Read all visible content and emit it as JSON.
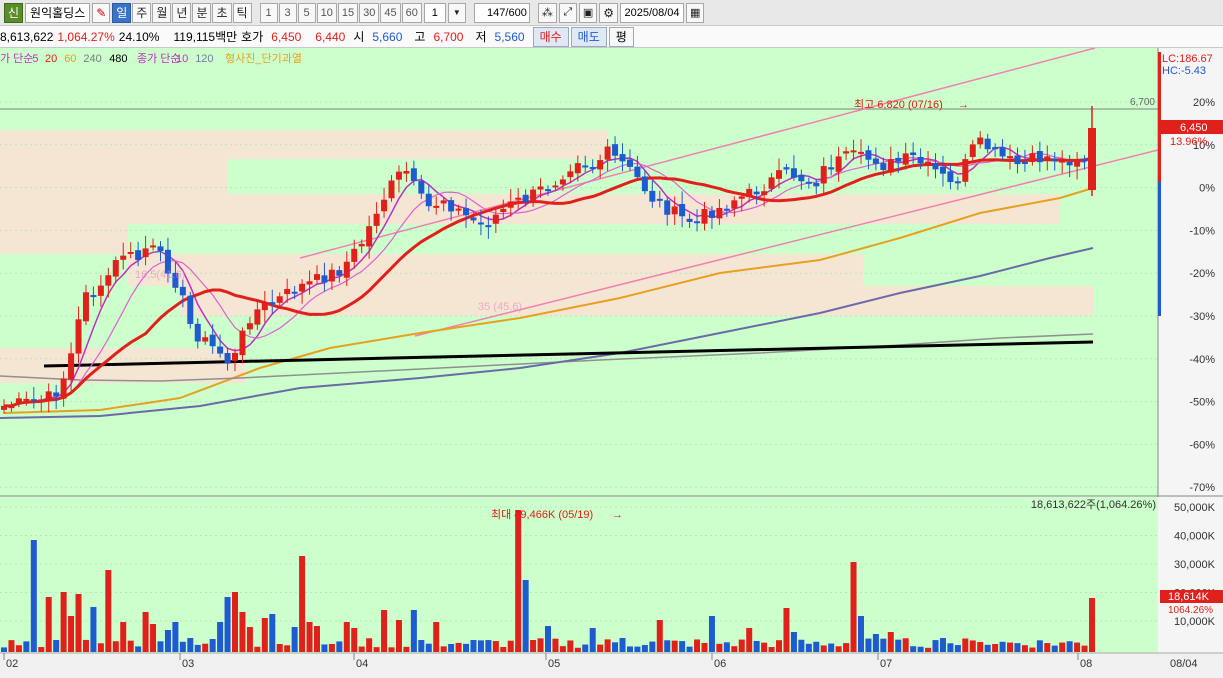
{
  "toolbar": {
    "badge": "신",
    "stock_name": "원익홀딩스",
    "period_tabs": [
      {
        "label": "일",
        "active": true
      },
      {
        "label": "주",
        "active": false
      },
      {
        "label": "월",
        "active": false
      },
      {
        "label": "년",
        "active": false
      },
      {
        "label": "분",
        "active": false
      },
      {
        "label": "초",
        "active": false
      },
      {
        "label": "틱",
        "active": false
      }
    ],
    "intervals": [
      "1",
      "3",
      "5",
      "10",
      "15",
      "30",
      "45",
      "60"
    ],
    "interval_value": "1",
    "count": "147",
    "count_total": "/600",
    "date": "2025/08/04",
    "icons": [
      "indicator-icon",
      "drawing-tool-icon",
      "save-icon",
      "settings-icon"
    ]
  },
  "infobar": {
    "volume_total": "8,613,622",
    "volume_ratio": "1,064.27%",
    "turnover": "24.10%",
    "trade_value": "119,115백만",
    "quote_label": "호가",
    "ask": "6,450",
    "bid": "6,440",
    "open_label": "시",
    "open": "5,660",
    "high_label": "고",
    "high": "6,700",
    "low_label": "저",
    "low": "5,560",
    "buy_label": "매수",
    "sell_label": "매도",
    "eval_label": "평"
  },
  "legend": {
    "price_ma_label": "가 단순",
    "price_ma_periods": [
      {
        "label": "5",
        "color": "#c030c0"
      },
      {
        "label": "20",
        "color": "#e0201a"
      },
      {
        "label": "60",
        "color": "#e8a020"
      },
      {
        "label": "240",
        "color": "#7a7a7a"
      },
      {
        "label": "480",
        "color": "#000000"
      }
    ],
    "close_ma_label": "종가 단순",
    "close_ma_periods": [
      {
        "label": "10",
        "color": "#c030c0"
      },
      {
        "label": "120",
        "color": "#7a7aa0"
      }
    ],
    "signal_label": "형사진_단기과열"
  },
  "price_axis": {
    "lc": "LC:186.67",
    "hc": "HC:-5.43",
    "ticks": [
      "20%",
      "10%",
      "0%",
      "-10%",
      "-20%",
      "-30%",
      "-40%",
      "-50%",
      "-60%",
      "-70%"
    ],
    "ref_price": "6,700",
    "current_price": "6,450",
    "current_pct": "13.96%"
  },
  "annotations": {
    "high_note": "최고 6,820 (07/16)",
    "volume_note": "최대 49,466K (05/19)",
    "volume_total_note": "18,613,622주(1,064.26%)",
    "faint_1": "16,5(41.6)",
    "faint_2": "35 (45.6)"
  },
  "volume_axis": {
    "ticks": [
      "50,000K",
      "40,000K",
      "30,000K",
      "20,000K",
      "10,000K"
    ],
    "current": "18,614K",
    "current_pct": "1064.26%"
  },
  "date_axis": {
    "labels": [
      "02",
      "03",
      "04",
      "05",
      "06",
      "07",
      "08"
    ],
    "current": "08/04"
  },
  "colors": {
    "up": "#e0201a",
    "down": "#1e5ad0",
    "chart_bg": "#ccffcc",
    "zone": "#f5e6d3",
    "ma5": "#c030c0",
    "ma20": "#e0201a",
    "ma60": "#e8a020",
    "ma120": "#6a6aa8",
    "ma240": "#909090",
    "ma480": "#000000",
    "channel": "#f080b0"
  }
}
